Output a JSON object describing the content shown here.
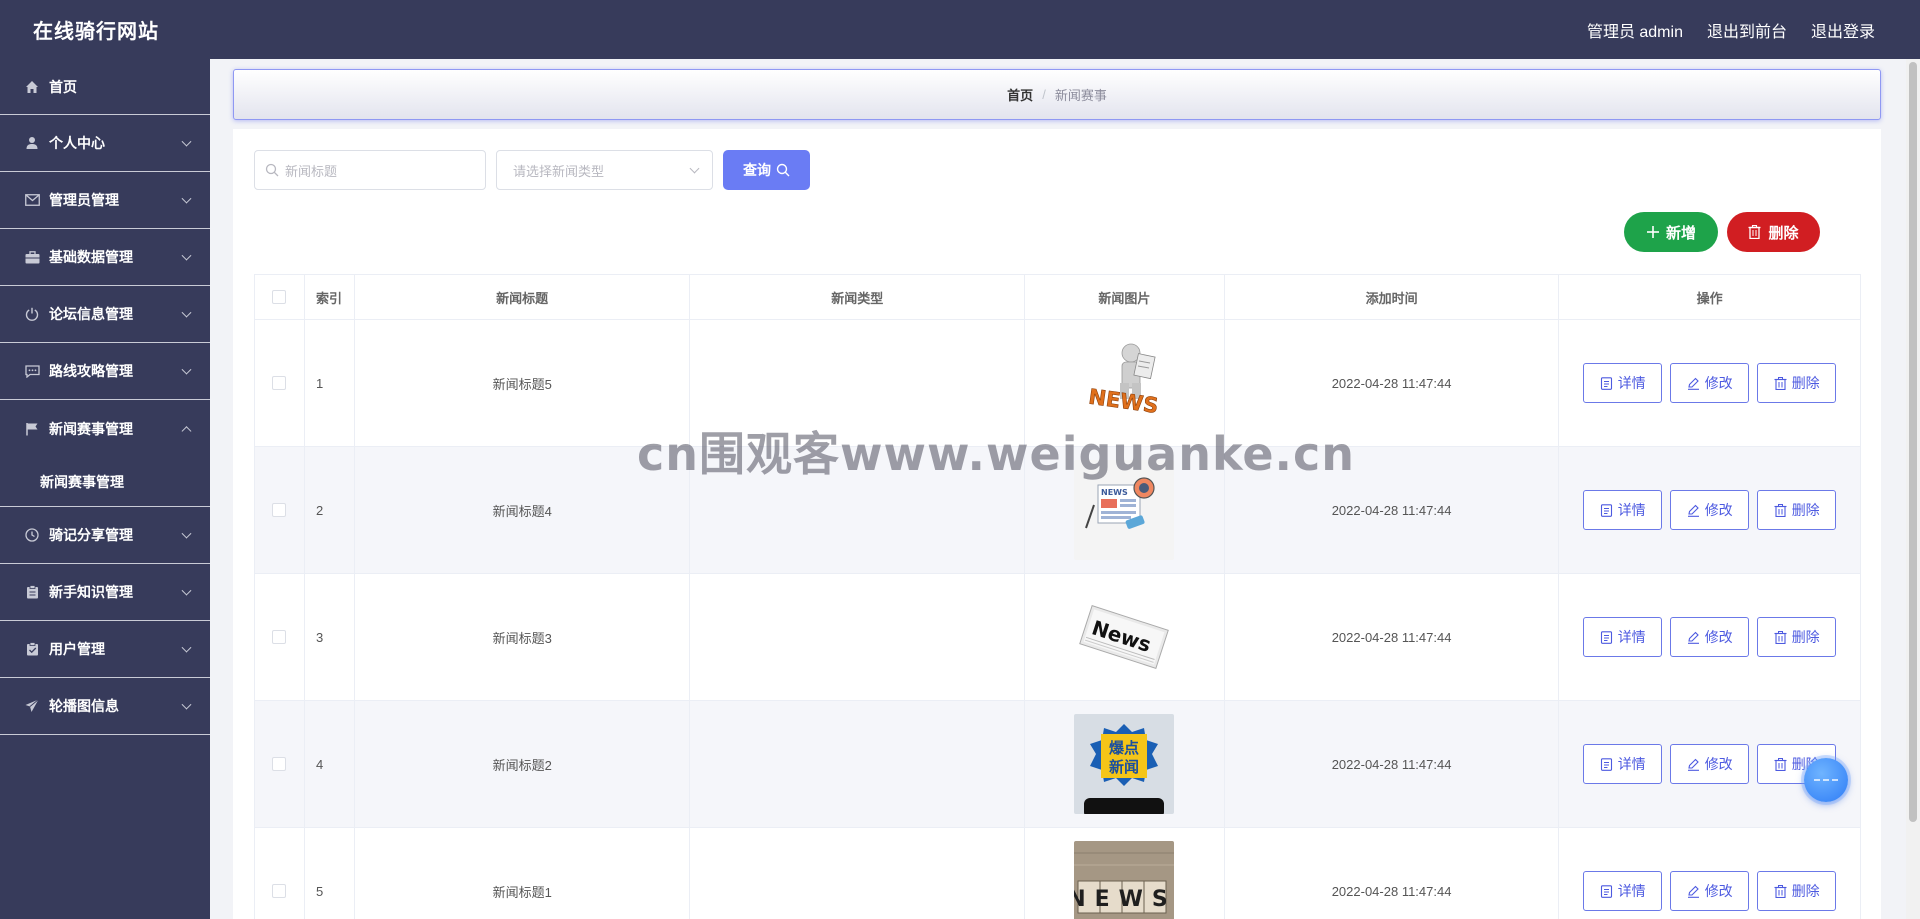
{
  "header": {
    "site_title": "在线骑行网站",
    "admin_label": "管理员 admin",
    "to_front_label": "退出到前台",
    "logout_label": "退出登录"
  },
  "sidebar": {
    "items": [
      {
        "label": "首页",
        "icon": "home-icon"
      },
      {
        "label": "个人中心",
        "icon": "user-icon"
      },
      {
        "label": "管理员管理",
        "icon": "mail-icon"
      },
      {
        "label": "基础数据管理",
        "icon": "briefcase-icon"
      },
      {
        "label": "论坛信息管理",
        "icon": "power-icon"
      },
      {
        "label": "路线攻略管理",
        "icon": "chat-icon"
      },
      {
        "label": "新闻赛事管理",
        "icon": "flag-icon"
      },
      {
        "label": "骑记分享管理",
        "icon": "clock-icon"
      },
      {
        "label": "新手知识管理",
        "icon": "clipboard-icon"
      },
      {
        "label": "用户管理",
        "icon": "checked-clipboard-icon"
      },
      {
        "label": "轮播图信息",
        "icon": "send-icon"
      }
    ],
    "submenu_label": "新闻赛事管理"
  },
  "breadcrumb": {
    "home": "首页",
    "separator": "/",
    "current": "新闻赛事"
  },
  "search": {
    "title_placeholder": "新闻标题",
    "type_placeholder": "请选择新闻类型",
    "query_label": "查询"
  },
  "actions": {
    "add_label": "新增",
    "delete_label": "删除"
  },
  "table": {
    "headers": [
      "索引",
      "新闻标题",
      "新闻类型",
      "新闻图片",
      "添加时间",
      "操作"
    ],
    "rows": [
      {
        "index": "1",
        "title": "新闻标题5",
        "type": "",
        "image": "news-3d-figure-image",
        "time": "2022-04-28 11:47:44"
      },
      {
        "index": "2",
        "title": "新闻标题4",
        "type": "",
        "image": "news-illustration-image",
        "time": "2022-04-28 11:47:44"
      },
      {
        "index": "3",
        "title": "新闻标题3",
        "type": "",
        "image": "news-newspaper-image",
        "time": "2022-04-28 11:47:44"
      },
      {
        "index": "4",
        "title": "新闻标题2",
        "type": "",
        "image": "breaking-news-image",
        "time": "2022-04-28 11:47:44"
      },
      {
        "index": "5",
        "title": "新闻标题1",
        "type": "",
        "image": "news-blocks-image",
        "time": "2022-04-28 11:47:44"
      }
    ],
    "op_labels": {
      "detail": "详情",
      "edit": "修改",
      "delete": "删除"
    },
    "image_texts": {
      "news1": "NEWS",
      "news2": "NEWS",
      "news3": "News",
      "news4_line1": "爆点",
      "news4_line2": "新闻",
      "news5": "NEWS"
    }
  },
  "watermark": "cn围观客www.weiguanke.cn",
  "colors": {
    "sidebar_bg": "#373b5b",
    "accent": "#6a7cf4",
    "add_green": "#1ea34a",
    "delete_red": "#d11e22"
  }
}
